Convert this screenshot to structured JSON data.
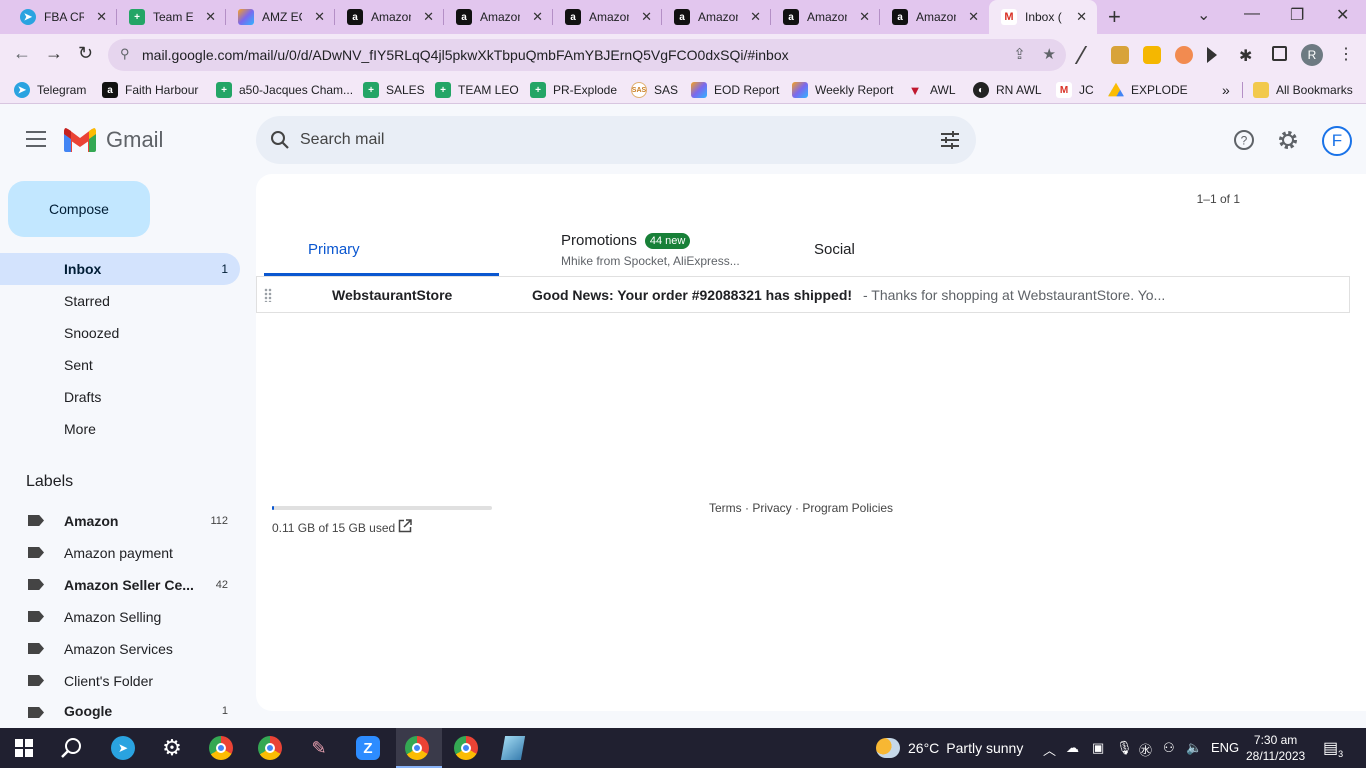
{
  "browser": {
    "tabs": [
      {
        "title": "FBA CR",
        "icon": "telegram-icon"
      },
      {
        "title": "Team Ex",
        "icon": "sheets-icon"
      },
      {
        "title": "AMZ EC",
        "icon": "clickup-icon"
      },
      {
        "title": "Amazon",
        "icon": "amazon-icon"
      },
      {
        "title": "Amazon",
        "icon": "amazon-icon"
      },
      {
        "title": "Amazon",
        "icon": "amazon-icon"
      },
      {
        "title": "Amazon",
        "icon": "amazon-icon"
      },
      {
        "title": "Amazon",
        "icon": "amazon-icon"
      },
      {
        "title": "Amazon",
        "icon": "amazon-icon"
      },
      {
        "title": "Inbox (",
        "icon": "gmail-icon",
        "active": true
      }
    ],
    "url": "mail.google.com/mail/u/0/d/ADwNV_fIY5RLqQ4jl5pkwXkTbpuQmbFAmYBJErnQ5VgFCO0dxSQi/#inbox",
    "profile_initial": "R",
    "bookmarks": [
      {
        "label": "Telegram",
        "icon": "telegram-icon"
      },
      {
        "label": "Faith Harbour",
        "icon": "amazon-icon"
      },
      {
        "label": "a50-Jacques Cham...",
        "icon": "sheets-icon"
      },
      {
        "label": "SALES",
        "icon": "sheets-icon"
      },
      {
        "label": "TEAM LEO",
        "icon": "sheets-icon"
      },
      {
        "label": "PR-Explode",
        "icon": "sheets-icon"
      },
      {
        "label": "SAS",
        "icon": "sas-icon"
      },
      {
        "label": "EOD Report",
        "icon": "clickup-icon"
      },
      {
        "label": "Weekly Report",
        "icon": "clickup-icon"
      },
      {
        "label": "AWL",
        "icon": "awl-icon"
      },
      {
        "label": "RN AWL",
        "icon": "rn-awl-icon"
      },
      {
        "label": "JC",
        "icon": "gmail-icon"
      },
      {
        "label": "EXPLODE",
        "icon": "drive-icon"
      }
    ],
    "bookmarks_overflow": "»",
    "all_bookmarks": "All Bookmarks"
  },
  "gmail": {
    "brand": "Gmail",
    "search_placeholder": "Search mail",
    "avatar_initial": "F",
    "compose": "Compose",
    "nav": [
      {
        "label": "Inbox",
        "count": "1",
        "active": true
      },
      {
        "label": "Starred",
        "count": ""
      },
      {
        "label": "Snoozed",
        "count": ""
      },
      {
        "label": "Sent",
        "count": ""
      },
      {
        "label": "Drafts",
        "count": ""
      },
      {
        "label": "More",
        "count": ""
      }
    ],
    "labels_title": "Labels",
    "labels": [
      {
        "label": "Amazon",
        "count": "112",
        "bold": true
      },
      {
        "label": "Amazon payment",
        "count": "",
        "bold": false
      },
      {
        "label": "Amazon Seller Ce...",
        "count": "42",
        "bold": true
      },
      {
        "label": "Amazon Selling",
        "count": "",
        "bold": false
      },
      {
        "label": "Amazon Services",
        "count": "",
        "bold": false
      },
      {
        "label": "Client's Folder",
        "count": "",
        "bold": false
      },
      {
        "label": "Google",
        "count": "1",
        "bold": true
      }
    ],
    "pager": "1–1 of 1",
    "tabs": {
      "primary": "Primary",
      "promotions": "Promotions",
      "promotions_badge": "44 new",
      "promotions_sub": "Mhike from Spocket, AliExpress...",
      "social": "Social"
    },
    "emails": [
      {
        "sender": "WebstaurantStore",
        "subject": "Good News: Your order #92088321 has shipped!",
        "snippet": " - Thanks for shopping at WebstaurantStore. Yo..."
      }
    ],
    "storage_text": "0.11 GB of 15 GB used",
    "storage_fraction": 0.0073,
    "footer": "Terms · Privacy · Program Policies"
  },
  "taskbar": {
    "weather_temp": "26°C",
    "weather_desc": "Partly sunny",
    "language": "ENG",
    "time": "7:30 am",
    "date": "28/11/2023",
    "notifications": "3"
  },
  "colors": {
    "chrome_frame": "#e2c6ee",
    "gmail_bg": "#f6f8fc",
    "compose_bg": "#c2e7ff",
    "inbox_active": "#d3e3fd",
    "primary_blue": "#0b57d0",
    "promo_badge": "#188038",
    "taskbar": "#202030"
  }
}
